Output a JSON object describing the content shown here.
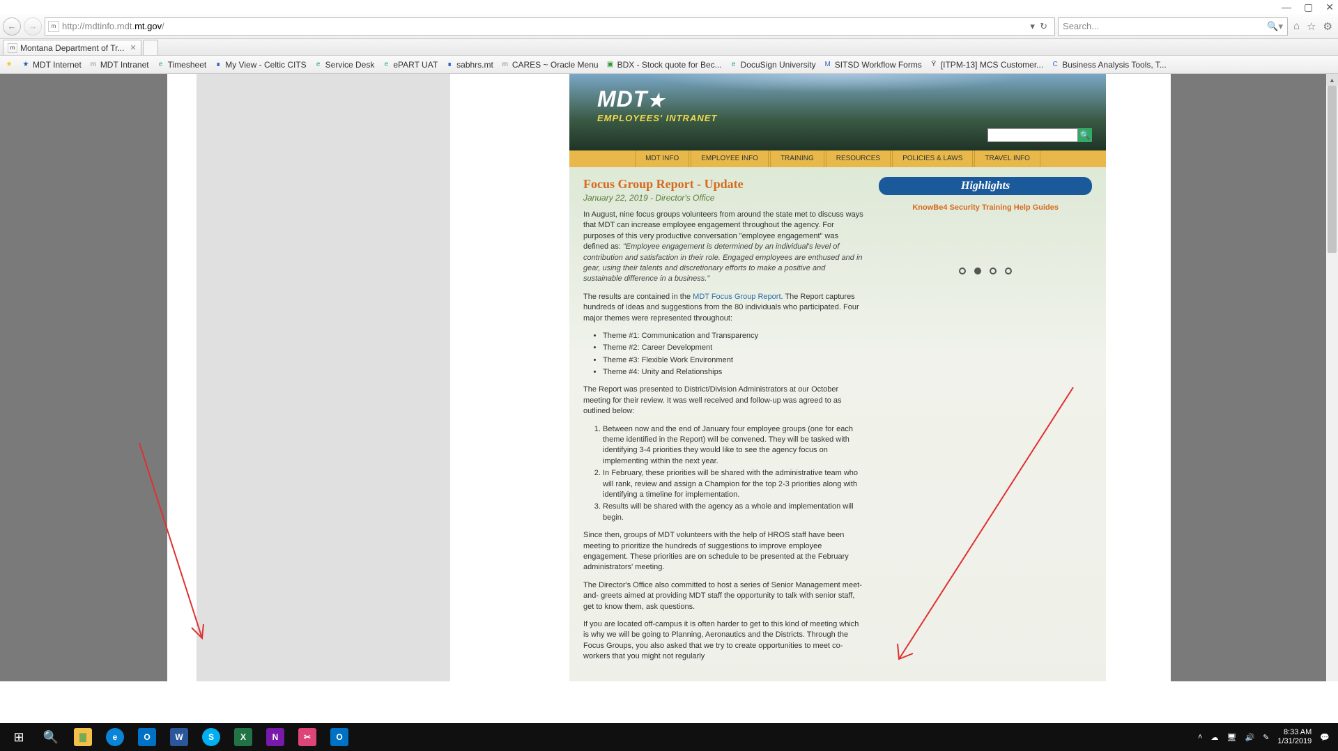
{
  "window": {
    "min": "—",
    "max": "▢",
    "close": "✕"
  },
  "url": {
    "proto": "http://",
    "sub": "mdtinfo.mdt.",
    "dom": "mt.gov",
    "rest": "/"
  },
  "search_placeholder": "Search...",
  "tab_title": "Montana Department of Tr...",
  "bookmarks": [
    {
      "icon": "★",
      "color": "#1a5fb4",
      "label": "MDT Internet"
    },
    {
      "icon": "m",
      "color": "#888",
      "label": "MDT Intranet"
    },
    {
      "icon": "e",
      "color": "#2a8",
      "label": "Timesheet"
    },
    {
      "icon": "∎",
      "color": "#36c",
      "label": "My View - Celtic CITS"
    },
    {
      "icon": "e",
      "color": "#2a8",
      "label": "Service Desk"
    },
    {
      "icon": "e",
      "color": "#2a8",
      "label": "ePART UAT"
    },
    {
      "icon": "∎",
      "color": "#36c",
      "label": "sabhrs.mt"
    },
    {
      "icon": "m",
      "color": "#888",
      "label": "CARES ~ Oracle Menu"
    },
    {
      "icon": "▣",
      "color": "#393",
      "label": "BDX - Stock quote for Bec..."
    },
    {
      "icon": "e",
      "color": "#2a8",
      "label": "DocuSign University"
    },
    {
      "icon": "M",
      "color": "#36c",
      "label": "SITSD Workflow Forms"
    },
    {
      "icon": "Ÿ",
      "color": "#333",
      "label": "[ITPM-13] MCS Customer..."
    },
    {
      "icon": "C",
      "color": "#36c",
      "label": "Business Analysis Tools, T..."
    }
  ],
  "site": {
    "logo": "MDT",
    "tagline": "EMPLOYEES' INTRANET",
    "nav": [
      "MDT INFO",
      "EMPLOYEE INFO",
      "TRAINING",
      "RESOURCES",
      "POLICIES & LAWS",
      "TRAVEL INFO"
    ]
  },
  "article": {
    "title": "Focus Group Report - Update",
    "sub": "January 22, 2019 - Director's Office",
    "p1a": "In August, nine focus groups volunteers from around the state met to discuss ways that MDT can increase employee engagement throughout the agency. For purposes of this very productive conversation \"employee engagement\" was defined as: ",
    "p1b": "\"Employee engagement is determined by an individual's level of contribution and satisfaction in their role. Engaged employees are enthused and in gear, using their talents and discretionary efforts to make a positive and sustainable difference in a business.\"",
    "p2a": "The results are contained in the ",
    "p2link": "MDT Focus Group Report",
    "p2b": ". The Report captures hundreds of ideas and suggestions from the 80 individuals who participated. Four major themes were represented throughout:",
    "themes": [
      "Theme #1: Communication and Transparency",
      "Theme #2: Career Development",
      "Theme #3: Flexible Work Environment",
      "Theme #4: Unity and Relationships"
    ],
    "p3": "The Report was presented to District/Division Administrators at our October meeting for their review. It was well received and follow-up was agreed to as outlined below:",
    "steps": [
      "Between now and the end of January four employee groups (one for each theme identified in the Report) will be convened. They will be tasked with identifying 3-4 priorities they would like to see the agency focus on implementing within the next year.",
      "In February, these priorities will be shared with the administrative team who will rank, review and assign a Champion for the top 2-3 priorities along with identifying a timeline for implementation.",
      "Results will be shared with the agency as a whole and implementation will begin."
    ],
    "p4": "Since then, groups of MDT volunteers with the help of HROS staff have been meeting to prioritize the hundreds of suggestions to improve employee engagement. These priorities are on schedule to be presented at the February administrators' meeting.",
    "p5": "The Director's Office also committed to host a series of Senior Management meet-and- greets aimed at providing MDT staff the opportunity to talk with senior staff, get to know them, ask questions.",
    "p6": "If you are located off-campus it is often harder to get to this kind of meeting which is why we will be going to Planning, Aeronautics and the Districts. Through the Focus Groups, you also asked that we try to create opportunities to meet co-workers that you might not regularly"
  },
  "highlights": {
    "title": "Highlights",
    "link": "KnowBe4 Security Training Help Guides"
  },
  "clock": {
    "time": "8:33 AM",
    "date": "1/31/2019"
  }
}
